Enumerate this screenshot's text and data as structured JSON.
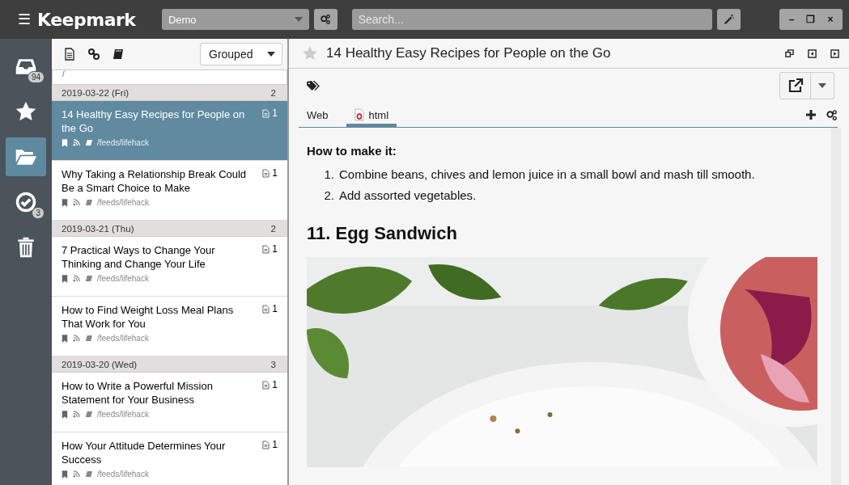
{
  "app": {
    "name": "Keepmark",
    "menu_glyph": "☰"
  },
  "library": {
    "value": "Demo"
  },
  "search": {
    "placeholder": "Search..."
  },
  "window_controls": [
    "–",
    "❐",
    "×"
  ],
  "sidebar": {
    "items": [
      {
        "kind": "inbox",
        "badge": "94",
        "selected": false
      },
      {
        "kind": "star",
        "selected": false
      },
      {
        "kind": "folder",
        "selected": true
      },
      {
        "kind": "check",
        "badge": "3",
        "selected": false
      },
      {
        "kind": "trash",
        "selected": false
      }
    ]
  },
  "list": {
    "view": "Grouped",
    "path": "/",
    "groups": [
      {
        "date": "2019-03-22 (Fri)",
        "count": "2",
        "items": [
          {
            "title": "14 Healthy Easy Recipes for People on the Go",
            "path": "/feeds/lifehack",
            "attachments": "1",
            "selected": true
          },
          {
            "title": "Why Taking a Relationship Break Could Be a Smart Choice to Make",
            "path": "/feeds/lifehack",
            "attachments": "1",
            "selected": false
          }
        ]
      },
      {
        "date": "2019-03-21 (Thu)",
        "count": "2",
        "items": [
          {
            "title": "7 Practical Ways to Change Your Thinking and Change Your Life",
            "path": "/feeds/lifehack",
            "attachments": "1",
            "selected": false
          },
          {
            "title": "How to Find Weight Loss Meal Plans That Work for You",
            "path": "/feeds/lifehack",
            "attachments": "1",
            "selected": false
          }
        ]
      },
      {
        "date": "2019-03-20 (Wed)",
        "count": "3",
        "items": [
          {
            "title": "How to Write a Powerful Mission Statement for Your Business",
            "path": "/feeds/lifehack",
            "attachments": "1",
            "selected": false
          },
          {
            "title": "How Your Attitude Determines Your Success",
            "path": "/feeds/lifehack",
            "attachments": "1",
            "selected": false
          }
        ]
      }
    ]
  },
  "document": {
    "title": "14 Healthy Easy Recipes for People on the Go",
    "starred": false,
    "tabs": [
      {
        "label": "Web",
        "kind": "web",
        "selected": false
      },
      {
        "label": "html",
        "kind": "file",
        "selected": true
      }
    ],
    "content": {
      "subheading": "How to make it:",
      "steps": [
        {
          "marker": "1.",
          "text": "Combine beans, chives and lemon juice in a small bowl and mash till smooth."
        },
        {
          "marker": "2.",
          "text": "Add assorted vegetables."
        }
      ],
      "heading": "11. Egg Sandwich"
    }
  }
}
